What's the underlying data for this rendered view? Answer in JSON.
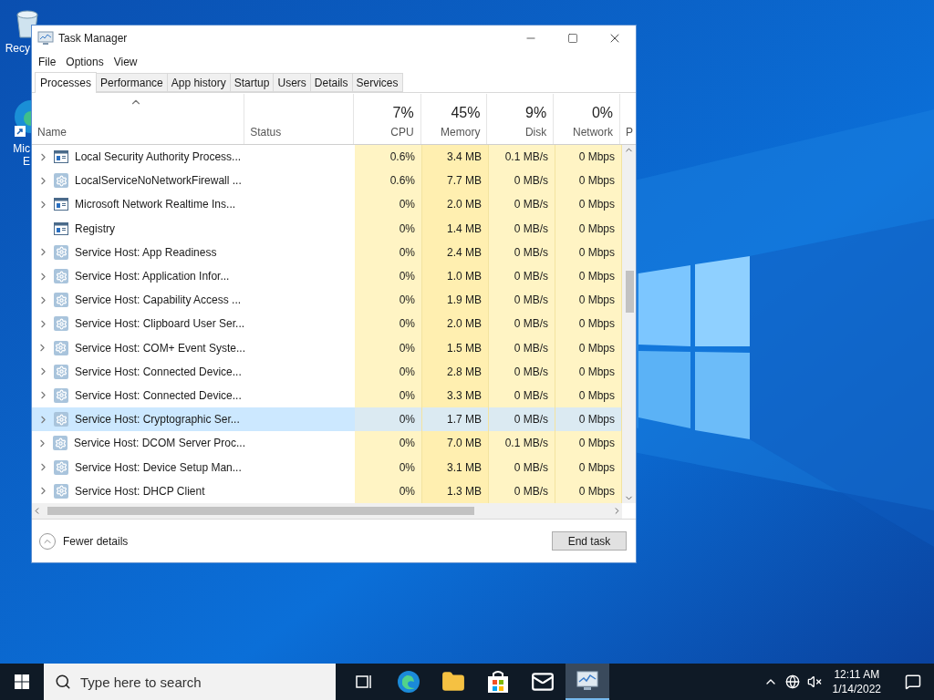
{
  "desktop_icons": [
    {
      "kind": "recycle",
      "lines": [
        "Recy"
      ]
    },
    {
      "kind": "edge",
      "lines": [
        "Mic",
        "E"
      ]
    }
  ],
  "window": {
    "title": "Task Manager",
    "menu": [
      "File",
      "Options",
      "View"
    ],
    "tabs": [
      {
        "label": "Processes",
        "selected": true
      },
      {
        "label": "Performance",
        "selected": false
      },
      {
        "label": "App history",
        "selected": false
      },
      {
        "label": "Startup",
        "selected": false
      },
      {
        "label": "Users",
        "selected": false
      },
      {
        "label": "Details",
        "selected": false
      },
      {
        "label": "Services",
        "selected": false
      }
    ],
    "columns": [
      {
        "name": "Name",
        "sorted": true
      },
      {
        "name": "Status",
        "sorted": false
      },
      {
        "percent": "7%",
        "name": "CPU",
        "sorted": false
      },
      {
        "percent": "45%",
        "name": "Memory",
        "sorted": false
      },
      {
        "percent": "9%",
        "name": "Disk",
        "sorted": false
      },
      {
        "percent": "0%",
        "name": "Network",
        "sorted": false
      },
      {
        "name": "P",
        "sorted": false
      }
    ],
    "rows": [
      {
        "kind": "window",
        "expandable": true,
        "selected": false,
        "cells": [
          "Local Security Authority Process...",
          "",
          "0.6%",
          "3.4 MB",
          "0.1 MB/s",
          "0 Mbps"
        ]
      },
      {
        "kind": "gear",
        "expandable": true,
        "selected": false,
        "cells": [
          "LocalServiceNoNetworkFirewall ...",
          "",
          "0.6%",
          "7.7 MB",
          "0 MB/s",
          "0 Mbps"
        ]
      },
      {
        "kind": "window",
        "expandable": true,
        "selected": false,
        "cells": [
          "Microsoft Network Realtime Ins...",
          "",
          "0%",
          "2.0 MB",
          "0 MB/s",
          "0 Mbps"
        ]
      },
      {
        "kind": "window",
        "expandable": false,
        "selected": false,
        "cells": [
          "Registry",
          "",
          "0%",
          "1.4 MB",
          "0 MB/s",
          "0 Mbps"
        ]
      },
      {
        "kind": "gear",
        "expandable": true,
        "selected": false,
        "cells": [
          "Service Host: App Readiness",
          "",
          "0%",
          "2.4 MB",
          "0 MB/s",
          "0 Mbps"
        ]
      },
      {
        "kind": "gear",
        "expandable": true,
        "selected": false,
        "cells": [
          "Service Host: Application Infor...",
          "",
          "0%",
          "1.0 MB",
          "0 MB/s",
          "0 Mbps"
        ]
      },
      {
        "kind": "gear",
        "expandable": true,
        "selected": false,
        "cells": [
          "Service Host: Capability Access ...",
          "",
          "0%",
          "1.9 MB",
          "0 MB/s",
          "0 Mbps"
        ]
      },
      {
        "kind": "gear",
        "expandable": true,
        "selected": false,
        "cells": [
          "Service Host: Clipboard User Ser...",
          "",
          "0%",
          "2.0 MB",
          "0 MB/s",
          "0 Mbps"
        ]
      },
      {
        "kind": "gear",
        "expandable": true,
        "selected": false,
        "cells": [
          "Service Host: COM+ Event Syste...",
          "",
          "0%",
          "1.5 MB",
          "0 MB/s",
          "0 Mbps"
        ]
      },
      {
        "kind": "gear",
        "expandable": true,
        "selected": false,
        "cells": [
          "Service Host: Connected Device...",
          "",
          "0%",
          "2.8 MB",
          "0 MB/s",
          "0 Mbps"
        ]
      },
      {
        "kind": "gear",
        "expandable": true,
        "selected": false,
        "cells": [
          "Service Host: Connected Device...",
          "",
          "0%",
          "3.3 MB",
          "0 MB/s",
          "0 Mbps"
        ]
      },
      {
        "kind": "gear",
        "expandable": true,
        "selected": true,
        "cells": [
          "Service Host: Cryptographic Ser...",
          "",
          "0%",
          "1.7 MB",
          "0 MB/s",
          "0 Mbps"
        ]
      },
      {
        "kind": "gear",
        "expandable": true,
        "selected": false,
        "cells": [
          "Service Host: DCOM Server Proc...",
          "",
          "0%",
          "7.0 MB",
          "0.1 MB/s",
          "0 Mbps"
        ]
      },
      {
        "kind": "gear",
        "expandable": true,
        "selected": false,
        "cells": [
          "Service Host: Device Setup Man...",
          "",
          "0%",
          "3.1 MB",
          "0 MB/s",
          "0 Mbps"
        ]
      },
      {
        "kind": "gear",
        "expandable": true,
        "selected": false,
        "cells": [
          "Service Host: DHCP Client",
          "",
          "0%",
          "1.3 MB",
          "0 MB/s",
          "0 Mbps"
        ]
      }
    ],
    "footer": {
      "toggle": "Fewer details",
      "button": "End task"
    }
  },
  "taskbar": {
    "search": {
      "placeholder": "Type here to search"
    },
    "apps": [
      {
        "kind": "taskview",
        "active": false
      },
      {
        "kind": "edge",
        "active": false
      },
      {
        "kind": "folder",
        "active": false
      },
      {
        "kind": "store",
        "active": false
      },
      {
        "kind": "mail",
        "active": false
      },
      {
        "kind": "taskmanager",
        "active": true
      }
    ],
    "time": "12:11 AM",
    "date": "1/14/2022"
  }
}
